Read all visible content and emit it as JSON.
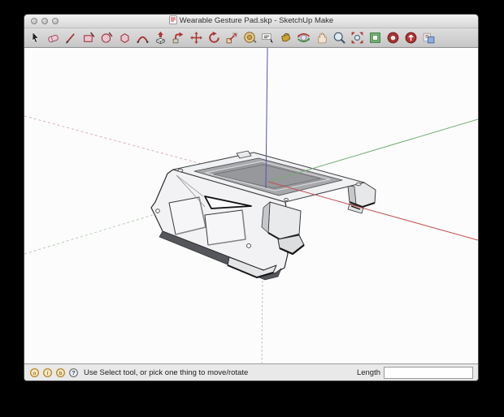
{
  "window": {
    "title": "Wearable Gesture Pad.skp - SketchUp Make",
    "document_icon": "sketchup-document-icon",
    "traffic_lights": [
      "close",
      "minimize",
      "zoom"
    ]
  },
  "toolbar": {
    "tools": [
      {
        "id": "select",
        "icon": "select-icon"
      },
      {
        "id": "eraser",
        "icon": "eraser-icon"
      },
      {
        "id": "line",
        "icon": "line-icon"
      },
      {
        "id": "rectangle",
        "icon": "rectangle-icon"
      },
      {
        "id": "circle",
        "icon": "circle-icon"
      },
      {
        "id": "polygon",
        "icon": "polygon-icon"
      },
      {
        "id": "arc",
        "icon": "arc-icon"
      },
      {
        "id": "push-pull",
        "icon": "pushpull-icon"
      },
      {
        "id": "follow-me",
        "icon": "followme-icon"
      },
      {
        "id": "move",
        "icon": "move-icon"
      },
      {
        "id": "rotate",
        "icon": "rotate-icon"
      },
      {
        "id": "scale",
        "icon": "scale-icon"
      },
      {
        "id": "tape-measure",
        "icon": "tape-measure-icon"
      },
      {
        "id": "text",
        "icon": "text-icon"
      },
      {
        "id": "paint-bucket",
        "icon": "paint-bucket-icon"
      },
      {
        "id": "orbit",
        "icon": "orbit-icon"
      },
      {
        "id": "pan",
        "icon": "pan-icon"
      },
      {
        "id": "zoom",
        "icon": "zoom-icon"
      },
      {
        "id": "zoom-extents",
        "icon": "zoom-extents-icon"
      },
      {
        "id": "component",
        "icon": "component-icon"
      },
      {
        "id": "get-models",
        "icon": "get-models-icon"
      },
      {
        "id": "share-model",
        "icon": "share-model-icon"
      },
      {
        "id": "send-to-layout",
        "icon": "send-to-layout-icon"
      }
    ]
  },
  "viewport": {
    "model": "wearable-gesture-pad",
    "axes": {
      "red": "#c25252",
      "green": "#74ac74",
      "blue": "#5252b4"
    }
  },
  "statusbar": {
    "icons": [
      {
        "name": "geolocation-badge-icon",
        "glyph": "o"
      },
      {
        "name": "credit-badge-icon",
        "glyph": "i"
      },
      {
        "name": "license-badge-icon",
        "glyph": "b"
      },
      {
        "name": "help-icon",
        "glyph": "?"
      }
    ],
    "message": "Use Select tool, or pick one thing to move/rotate",
    "length_label": "Length",
    "length_value": ""
  }
}
